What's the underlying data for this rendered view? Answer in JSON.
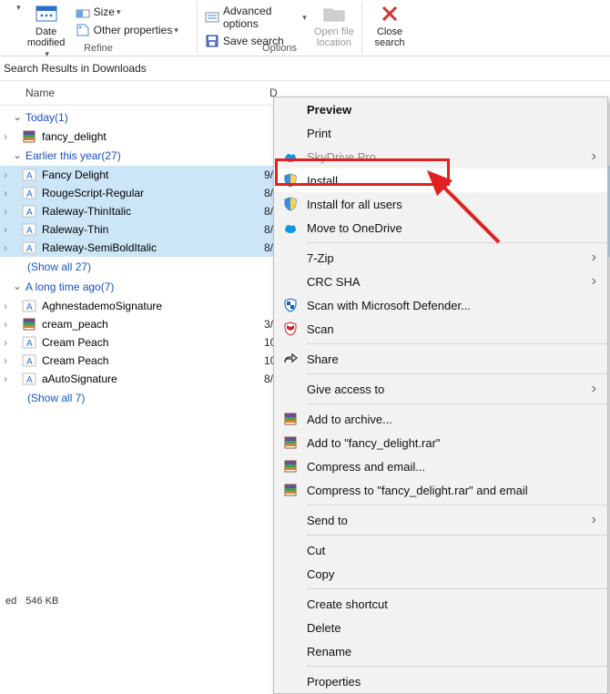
{
  "ribbon": {
    "date_modified": "Date\nmodified",
    "size": "Size",
    "other_properties": "Other properties",
    "advanced_options": "Advanced options",
    "save_search": "Save search",
    "open_file_location": "Open file\nlocation",
    "close_search": "Close\nsearch",
    "group_refine": "Refine",
    "group_options": "Options"
  },
  "breadcrumb": "Search Results in Downloads",
  "columns": {
    "name": "Name",
    "date": "D"
  },
  "groups": [
    {
      "title": "Today",
      "count": "(1)",
      "show_all": null,
      "rows": [
        {
          "icon": "rar",
          "name": "fancy_delight",
          "date": "",
          "sel": false
        }
      ]
    },
    {
      "title": "Earlier this year",
      "count": "(27)",
      "show_all": "(Show all 27)",
      "rows": [
        {
          "icon": "font",
          "name": "Fancy Delight",
          "date": "9/",
          "sel": true
        },
        {
          "icon": "font",
          "name": "RougeScript-Regular",
          "date": "8/",
          "sel": true
        },
        {
          "icon": "font",
          "name": "Raleway-ThinItalic",
          "date": "8/",
          "sel": true
        },
        {
          "icon": "font",
          "name": "Raleway-Thin",
          "date": "8/",
          "sel": true
        },
        {
          "icon": "font",
          "name": "Raleway-SemiBoldItalic",
          "date": "8/",
          "sel": true
        }
      ]
    },
    {
      "title": "A long time ago",
      "count": "(7)",
      "show_all": "(Show all 7)",
      "rows": [
        {
          "icon": "font",
          "name": "AghnestademoSignature",
          "date": "",
          "sel": false
        },
        {
          "icon": "rar",
          "name": "cream_peach",
          "date": "3/",
          "sel": false
        },
        {
          "icon": "font",
          "name": "Cream Peach",
          "date": "10",
          "sel": false
        },
        {
          "icon": "font",
          "name": "Cream Peach",
          "date": "10",
          "sel": false
        },
        {
          "icon": "font",
          "name": "aAutoSignature",
          "date": "8/",
          "sel": false
        }
      ]
    }
  ],
  "context_menu": [
    {
      "type": "item",
      "label": "Preview",
      "bold": true
    },
    {
      "type": "item",
      "label": "Print"
    },
    {
      "type": "item",
      "label": "SkyDrive Pro",
      "icon": "cloud-blue",
      "disabled": true,
      "sub": true
    },
    {
      "type": "item",
      "label": "Install",
      "icon": "shield",
      "highlight": true
    },
    {
      "type": "item",
      "label": "Install for all users",
      "icon": "shield"
    },
    {
      "type": "item",
      "label": "Move to OneDrive",
      "icon": "cloud-blue"
    },
    {
      "type": "sep"
    },
    {
      "type": "item",
      "label": "7-Zip",
      "sub": true
    },
    {
      "type": "item",
      "label": "CRC SHA",
      "sub": true
    },
    {
      "type": "item",
      "label": "Scan with Microsoft Defender...",
      "icon": "defender"
    },
    {
      "type": "item",
      "label": "Scan",
      "icon": "mcafee"
    },
    {
      "type": "sep"
    },
    {
      "type": "item",
      "label": "Share",
      "icon": "share"
    },
    {
      "type": "sep"
    },
    {
      "type": "item",
      "label": "Give access to",
      "sub": true
    },
    {
      "type": "sep"
    },
    {
      "type": "item",
      "label": "Add to archive...",
      "icon": "rar"
    },
    {
      "type": "item",
      "label": "Add to \"fancy_delight.rar\"",
      "icon": "rar"
    },
    {
      "type": "item",
      "label": "Compress and email...",
      "icon": "rar"
    },
    {
      "type": "item",
      "label": "Compress to \"fancy_delight.rar\" and email",
      "icon": "rar"
    },
    {
      "type": "sep"
    },
    {
      "type": "item",
      "label": "Send to",
      "sub": true
    },
    {
      "type": "sep"
    },
    {
      "type": "item",
      "label": "Cut"
    },
    {
      "type": "item",
      "label": "Copy"
    },
    {
      "type": "sep"
    },
    {
      "type": "item",
      "label": "Create shortcut"
    },
    {
      "type": "item",
      "label": "Delete"
    },
    {
      "type": "item",
      "label": "Rename"
    },
    {
      "type": "sep"
    },
    {
      "type": "item",
      "label": "Properties"
    }
  ],
  "status": {
    "selected": "ed",
    "size": "546 KB"
  }
}
